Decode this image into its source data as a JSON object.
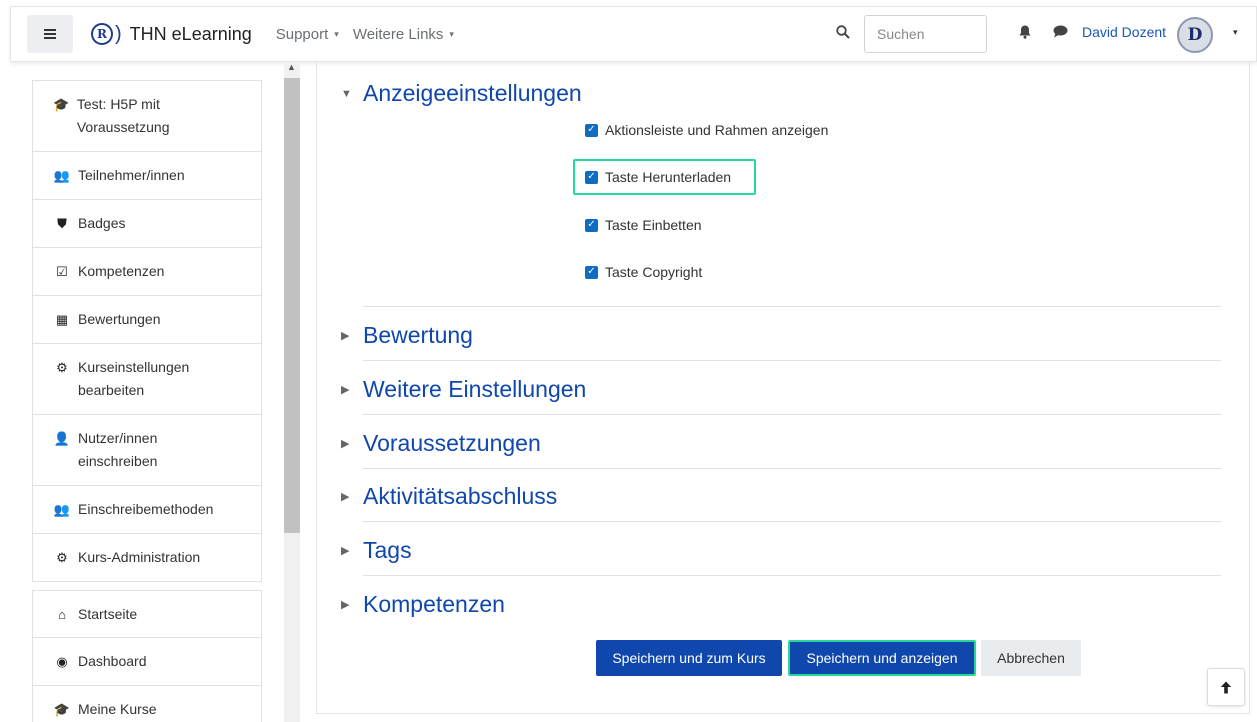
{
  "header": {
    "menu_icon": "hamburger-icon",
    "brand_logo": "R",
    "brand_name": "THN eLearning",
    "nav": [
      {
        "label": "Support",
        "caret": "▾"
      },
      {
        "label": "Weitere Links",
        "caret": "▾"
      }
    ],
    "search_placeholder": "Suchen",
    "user_name": "David Dozent",
    "avatar_letter": "D"
  },
  "sidebar": {
    "group1": [
      {
        "icon": "graduation-cap-icon",
        "glyph": "🎓",
        "label": "Test: H5P mit Voraussetzung"
      },
      {
        "icon": "users-icon",
        "glyph": "👥",
        "label": "Teilnehmer/innen"
      },
      {
        "icon": "shield-icon",
        "glyph": "⛊",
        "label": "Badges"
      },
      {
        "icon": "check-square-icon",
        "glyph": "☑",
        "label": "Kompetenzen"
      },
      {
        "icon": "table-icon",
        "glyph": "▦",
        "label": "Bewertungen"
      },
      {
        "icon": "gear-icon",
        "glyph": "⚙",
        "label": "Kurseinstellungen bearbeiten"
      },
      {
        "icon": "user-plus-icon",
        "glyph": "👤",
        "label": "Nutzer/innen einschreiben"
      },
      {
        "icon": "users-icon",
        "glyph": "👥",
        "label": "Einschreibemethoden"
      },
      {
        "icon": "gear-icon",
        "glyph": "⚙",
        "label": "Kurs-Administration"
      }
    ],
    "group2": [
      {
        "icon": "home-icon",
        "glyph": "⌂",
        "label": "Startseite"
      },
      {
        "icon": "dashboard-icon",
        "glyph": "◉",
        "label": "Dashboard"
      },
      {
        "icon": "graduation-cap-icon",
        "glyph": "🎓",
        "label": "Meine Kurse"
      }
    ]
  },
  "main": {
    "section_expanded": "Anzeigeeinstellungen",
    "checkboxes": [
      {
        "label": "Aktionsleiste und Rahmen anzeigen",
        "checked": true
      },
      {
        "label": "Taste Herunterladen",
        "checked": true
      },
      {
        "label": "Taste Einbetten",
        "checked": true
      },
      {
        "label": "Taste Copyright",
        "checked": true
      }
    ],
    "sections_collapsed": [
      "Bewertung",
      "Weitere Einstellungen",
      "Voraussetzungen",
      "Aktivitätsabschluss",
      "Tags",
      "Kompetenzen"
    ],
    "buttons": {
      "save_course": "Speichern und zum Kurs",
      "save_show": "Speichern und anzeigen",
      "cancel": "Abbrechen"
    },
    "back_to_top_icon": "arrow-up-icon"
  },
  "colors": {
    "primary": "#0f47ad",
    "highlight": "#28d89a",
    "checkbox": "#0f6cbf"
  }
}
